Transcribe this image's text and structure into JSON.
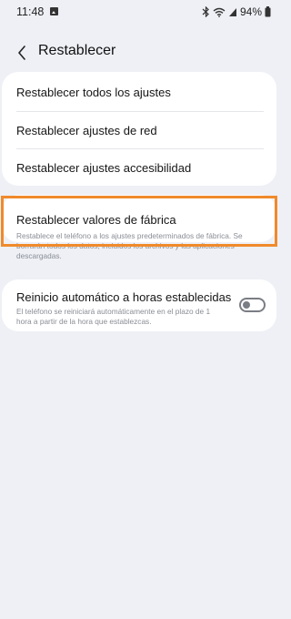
{
  "status_bar": {
    "time": "11:48",
    "battery": "94%"
  },
  "header": {
    "title": "Restablecer"
  },
  "reset_options": [
    {
      "label": "Restablecer todos los ajustes"
    },
    {
      "label": "Restablecer ajustes de red"
    },
    {
      "label": "Restablecer ajustes accesibilidad"
    }
  ],
  "factory_reset": {
    "title": "Restablecer valores de fábrica",
    "description": "Restablece el teléfono a los ajustes predeterminados de fábrica. Se borrarán todos los datos, incluidos los archivos y las aplicaciones descargadas."
  },
  "auto_restart": {
    "title": "Reinicio automático a horas establecidas",
    "description": "El teléfono se reiniciará automáticamente en el plazo de 1 hora a partir de la hora que establezcas.",
    "enabled": false
  },
  "colors": {
    "background": "#eef0f5",
    "card": "#ffffff",
    "highlight": "#f08a2b"
  }
}
